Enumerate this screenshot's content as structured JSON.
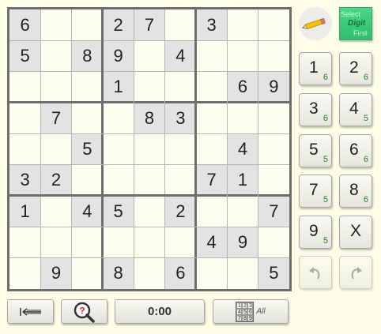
{
  "board": {
    "rows": [
      [
        "6",
        "",
        "",
        "2",
        "7",
        "",
        "3",
        "",
        ""
      ],
      [
        "5",
        "",
        "8",
        "9",
        "",
        "4",
        "",
        "",
        ""
      ],
      [
        "",
        "",
        "",
        "1",
        "",
        "",
        "",
        "6",
        "9"
      ],
      [
        "",
        "7",
        "",
        "",
        "8",
        "3",
        "",
        "",
        ""
      ],
      [
        "",
        "",
        "5",
        "",
        "",
        "",
        "",
        "4",
        ""
      ],
      [
        "3",
        "2",
        "",
        "",
        "",
        "",
        "7",
        "1",
        ""
      ],
      [
        "1",
        "",
        "4",
        "5",
        "",
        "2",
        "",
        "",
        "7"
      ],
      [
        "",
        "",
        "",
        "",
        "",
        "",
        "4",
        "9",
        ""
      ],
      [
        "",
        "9",
        "",
        "8",
        "",
        "6",
        "",
        "",
        "5"
      ]
    ]
  },
  "toolbar": {
    "select_first": [
      "Select",
      "Digit",
      "First"
    ],
    "digits": [
      {
        "label": "1",
        "count": "6"
      },
      {
        "label": "2",
        "count": "6"
      },
      {
        "label": "3",
        "count": "6"
      },
      {
        "label": "4",
        "count": "5"
      },
      {
        "label": "5",
        "count": "5"
      },
      {
        "label": "6",
        "count": "6"
      },
      {
        "label": "7",
        "count": "5"
      },
      {
        "label": "8",
        "count": "6"
      },
      {
        "label": "9",
        "count": "5"
      }
    ],
    "clear_label": "X"
  },
  "bottom": {
    "timer": "0:00",
    "mini_grid": [
      "1",
      "2",
      "3",
      "4",
      "5",
      "6",
      "7",
      "8",
      "9"
    ],
    "all_label": "All"
  },
  "icons": {
    "pencil": "pencil-icon",
    "back": "back-to-start-icon",
    "hint": "magnifier-question-icon",
    "undo": "undo-icon",
    "redo": "redo-icon"
  }
}
